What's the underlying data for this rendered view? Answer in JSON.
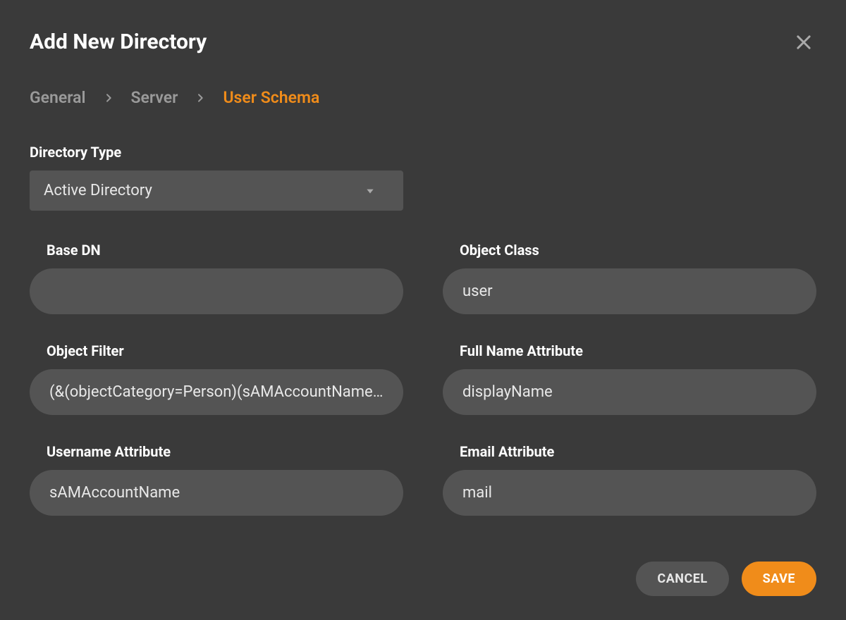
{
  "dialog": {
    "title": "Add New Directory"
  },
  "breadcrumb": {
    "items": [
      {
        "label": "General",
        "active": false
      },
      {
        "label": "Server",
        "active": false
      },
      {
        "label": "User Schema",
        "active": true
      }
    ]
  },
  "directory_type": {
    "label": "Directory Type",
    "value": "Active Directory"
  },
  "fields": {
    "base_dn": {
      "label": "Base DN",
      "value": ""
    },
    "object_class": {
      "label": "Object Class",
      "value": "user"
    },
    "object_filter": {
      "label": "Object Filter",
      "value": "(&(objectCategory=Person)(sAMAccountName=*))"
    },
    "full_name_attribute": {
      "label": "Full Name Attribute",
      "value": "displayName"
    },
    "username_attribute": {
      "label": "Username Attribute",
      "value": "sAMAccountName"
    },
    "email_attribute": {
      "label": "Email Attribute",
      "value": "mail"
    }
  },
  "footer": {
    "cancel_label": "CANCEL",
    "save_label": "SAVE"
  }
}
